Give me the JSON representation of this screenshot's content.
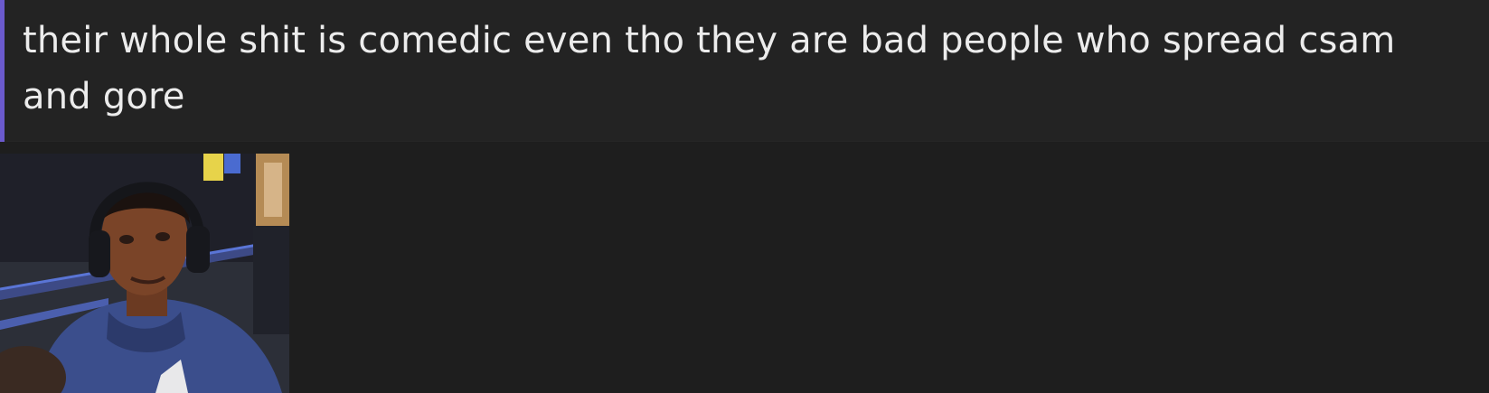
{
  "message": {
    "text": "their whole shit is comedic even tho they are bad people who spread csam and gore"
  },
  "attachment": {
    "type": "gif",
    "subject": "person-with-headphones-looking-sideways"
  },
  "colors": {
    "page_background": "#1e1e1e",
    "message_background": "#232323",
    "accent": "#6b5acd",
    "text": "#ececec"
  }
}
